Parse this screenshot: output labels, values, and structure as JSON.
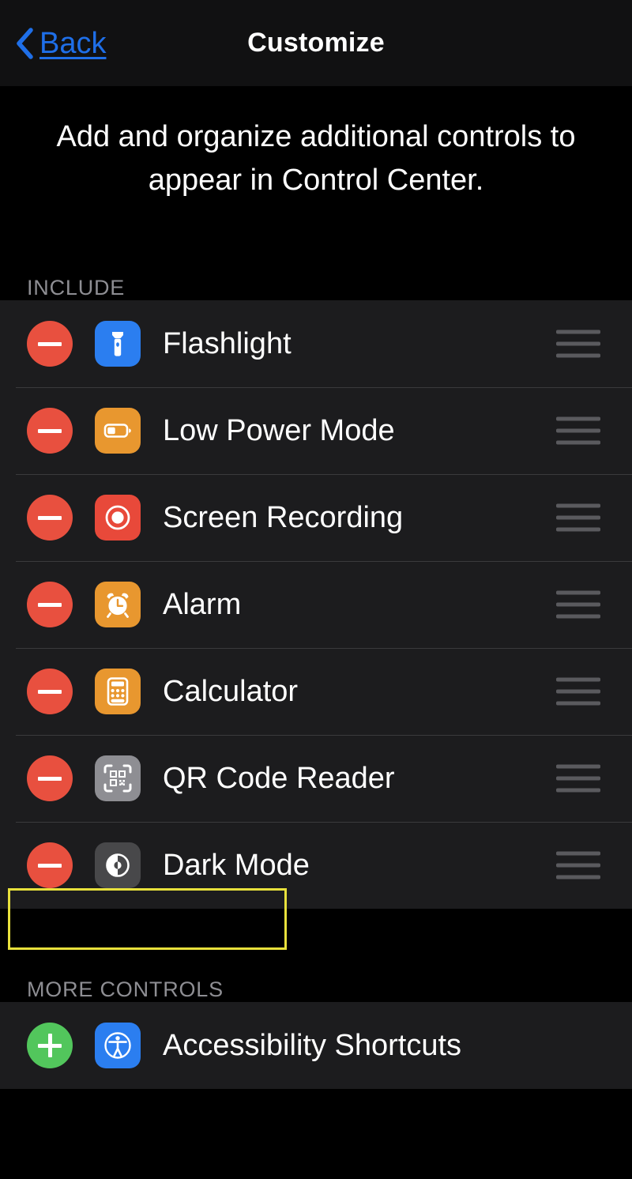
{
  "navbar": {
    "back_label": "Back",
    "back_icon": "chevron-left-icon",
    "title": "Customize"
  },
  "description": "Add and organize additional controls to appear in Control Center.",
  "colors": {
    "accent_blue": "#1f6fe8",
    "remove_red": "#e8503f",
    "add_green": "#52c65c",
    "highlight_yellow": "#e8e13c",
    "row_background": "#1c1c1e",
    "page_background": "#000000",
    "separator": "#3a3a3c",
    "section_header_text": "#8e8e93"
  },
  "sections": [
    {
      "id": "include",
      "header": "INCLUDE",
      "highlighted": false,
      "rows": [
        {
          "label": "Flashlight",
          "action": "remove",
          "action_icon": "minus-circle-icon",
          "icon": "flashlight-icon",
          "icon_bg": "#2b7ef0",
          "handle": "drag-handle-icon"
        },
        {
          "label": "Low Power Mode",
          "action": "remove",
          "action_icon": "minus-circle-icon",
          "icon": "battery-low-icon",
          "icon_bg": "#e8972f",
          "handle": "drag-handle-icon"
        },
        {
          "label": "Screen Recording",
          "action": "remove",
          "action_icon": "minus-circle-icon",
          "icon": "record-icon",
          "icon_bg": "#e8493a",
          "handle": "drag-handle-icon"
        },
        {
          "label": "Alarm",
          "action": "remove",
          "action_icon": "minus-circle-icon",
          "icon": "alarm-clock-icon",
          "icon_bg": "#e8972f",
          "handle": "drag-handle-icon"
        },
        {
          "label": "Calculator",
          "action": "remove",
          "action_icon": "minus-circle-icon",
          "icon": "calculator-icon",
          "icon_bg": "#e8972f",
          "handle": "drag-handle-icon"
        },
        {
          "label": "QR Code Reader",
          "action": "remove",
          "action_icon": "minus-circle-icon",
          "icon": "qr-code-icon",
          "icon_bg": "#8e8e93",
          "handle": "drag-handle-icon"
        },
        {
          "label": "Dark Mode",
          "action": "remove",
          "action_icon": "minus-circle-icon",
          "icon": "dark-mode-icon",
          "icon_bg": "#48484a",
          "handle": "drag-handle-icon"
        }
      ]
    },
    {
      "id": "more-controls",
      "header": "MORE CONTROLS",
      "highlighted": true,
      "rows": [
        {
          "label": "Accessibility Shortcuts",
          "action": "add",
          "action_icon": "plus-circle-icon",
          "icon": "accessibility-icon",
          "icon_bg": "#2b7ef0",
          "handle": null
        }
      ]
    }
  ]
}
